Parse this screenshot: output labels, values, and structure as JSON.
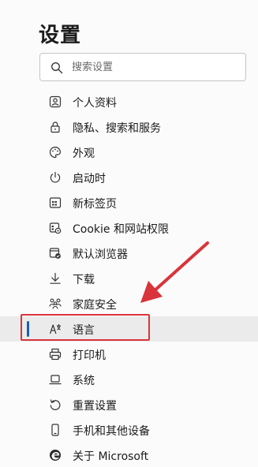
{
  "page": {
    "title": "设置"
  },
  "search": {
    "placeholder": "搜索设置",
    "value": ""
  },
  "menu": {
    "items": [
      {
        "label": "个人资料",
        "icon": "profile-icon"
      },
      {
        "label": "隐私、搜索和服务",
        "icon": "lock-icon"
      },
      {
        "label": "外观",
        "icon": "palette-icon"
      },
      {
        "label": "启动时",
        "icon": "power-icon"
      },
      {
        "label": "新标签页",
        "icon": "new-tab-icon"
      },
      {
        "label": "Cookie 和网站权限",
        "icon": "site-permissions-icon"
      },
      {
        "label": "默认浏览器",
        "icon": "default-browser-icon"
      },
      {
        "label": "下载",
        "icon": "download-icon"
      },
      {
        "label": "家庭安全",
        "icon": "family-icon"
      },
      {
        "label": "语言",
        "icon": "language-icon",
        "selected": true
      },
      {
        "label": "打印机",
        "icon": "printer-icon"
      },
      {
        "label": "系统",
        "icon": "laptop-icon"
      },
      {
        "label": "重置设置",
        "icon": "reset-icon"
      },
      {
        "label": "手机和其他设备",
        "icon": "phone-icon"
      },
      {
        "label": "关于 Microsoft",
        "icon": "edge-logo-icon"
      }
    ]
  },
  "colors": {
    "accent": "#1a5fb4",
    "annotation": "#d9343b",
    "selected_bg": "#ebebeb"
  }
}
